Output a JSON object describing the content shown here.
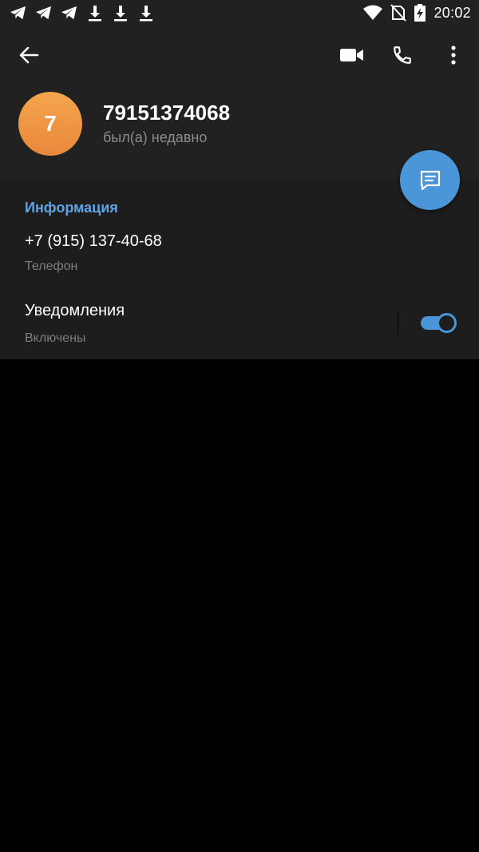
{
  "status_bar": {
    "time": "20:02",
    "left_icons": [
      "telegram-icon",
      "telegram-icon",
      "telegram-icon",
      "download-icon",
      "download-icon",
      "download-icon"
    ],
    "right_icons": [
      "wifi-icon",
      "no-sim-icon",
      "battery-charging-icon"
    ]
  },
  "toolbar": {
    "back_icon": "arrow-left-icon",
    "actions": [
      "video-call-icon",
      "phone-call-icon",
      "more-vert-icon"
    ]
  },
  "profile": {
    "avatar_letter": "7",
    "name": "79151374068",
    "status": "был(а) недавно",
    "avatar_color": "#f0984a"
  },
  "fab": {
    "icon": "message-icon",
    "color": "#4a96d9"
  },
  "info": {
    "section_title": "Информация",
    "phone_value": "+7 (915) 137-40-68",
    "phone_label": "Телефон",
    "notifications_title": "Уведомления",
    "notifications_status": "Включены",
    "notifications_enabled": true
  },
  "colors": {
    "accent": "#4a96d9",
    "section_title": "#5ea5e8",
    "header_bg": "#212121",
    "section_bg": "#1d1d1d",
    "secondary_text": "#7e7e7e"
  }
}
